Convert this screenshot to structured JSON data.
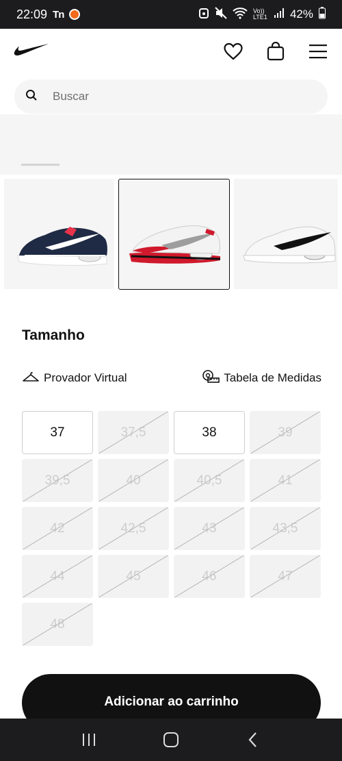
{
  "status_bar": {
    "time": "22:09",
    "carrier_badge": "Tn",
    "network_label": "Vo)) LTE1",
    "battery": "42%"
  },
  "header": {
    "brand": "nike-swoosh-logo",
    "icons": [
      "heart-icon",
      "bag-icon",
      "menu-icon"
    ]
  },
  "search": {
    "placeholder": "Buscar"
  },
  "thumbnails": [
    {
      "variant": "navy-blue",
      "selected": false,
      "primary_color": "#1f2a44",
      "accent_color": "#ffffff"
    },
    {
      "variant": "white-red",
      "selected": true,
      "primary_color": "#d0192c",
      "accent_color": "#9e9e9e"
    },
    {
      "variant": "white-black",
      "selected": false,
      "primary_color": "#f0f0f0",
      "accent_color": "#111111"
    }
  ],
  "size_section": {
    "title": "Tamanho",
    "virtual_fitting_label": "Provador Virtual",
    "size_chart_label": "Tabela de Medidas",
    "sizes": [
      {
        "label": "37",
        "available": true
      },
      {
        "label": "37,5",
        "available": false
      },
      {
        "label": "38",
        "available": true
      },
      {
        "label": "39",
        "available": false
      },
      {
        "label": "39,5",
        "available": false
      },
      {
        "label": "40",
        "available": false
      },
      {
        "label": "40,5",
        "available": false
      },
      {
        "label": "41",
        "available": false
      },
      {
        "label": "42",
        "available": false
      },
      {
        "label": "42,5",
        "available": false
      },
      {
        "label": "43",
        "available": false
      },
      {
        "label": "43,5",
        "available": false
      },
      {
        "label": "44",
        "available": false
      },
      {
        "label": "45",
        "available": false
      },
      {
        "label": "46",
        "available": false
      },
      {
        "label": "47",
        "available": false
      },
      {
        "label": "48",
        "available": false
      }
    ]
  },
  "cta": {
    "add_to_cart_label": "Adicionar ao carrinho"
  },
  "colors": {
    "primary": "#111111",
    "surface": "#f5f5f5",
    "unavailable_text": "#cdcdcd"
  }
}
